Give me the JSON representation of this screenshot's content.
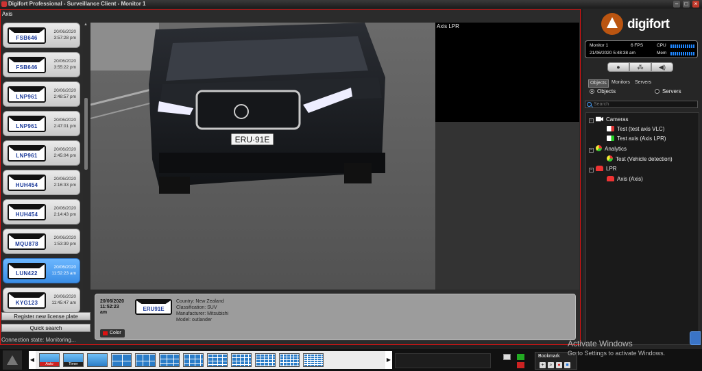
{
  "window": {
    "title": "Digifort Professional - Surveillance Client - Monitor 1"
  },
  "monitor": {
    "label": "Axis",
    "connection_state": "Connection state: Monitoring..."
  },
  "plates": [
    {
      "plate": "FSB646",
      "date": "20/06/2020",
      "time": "3:57:28 pm",
      "selected": false
    },
    {
      "plate": "FSB646",
      "date": "20/06/2020",
      "time": "3:55:22 pm",
      "selected": false
    },
    {
      "plate": "LNP961",
      "date": "20/06/2020",
      "time": "2:48:57 pm",
      "selected": false
    },
    {
      "plate": "LNP961",
      "date": "20/06/2020",
      "time": "2:47:01 pm",
      "selected": false
    },
    {
      "plate": "LNP961",
      "date": "20/06/2020",
      "time": "2:45:04 pm",
      "selected": false
    },
    {
      "plate": "HUH454",
      "date": "20/06/2020",
      "time": "2:16:33 pm",
      "selected": false
    },
    {
      "plate": "HUH454",
      "date": "20/06/2020",
      "time": "2:14:43 pm",
      "selected": false
    },
    {
      "plate": "MQU878",
      "date": "20/06/2020",
      "time": "1:53:39 pm",
      "selected": false
    },
    {
      "plate": "LUN422",
      "date": "20/06/2020",
      "time": "11:52:23 am",
      "selected": true
    },
    {
      "plate": "KYG123",
      "date": "20/06/2020",
      "time": "11:45:47 am",
      "selected": false
    }
  ],
  "buttons": {
    "register": "Register new license plate",
    "quick_search": "Quick search"
  },
  "video": {
    "title": "Axis LPR",
    "plate_on_car": "ERU·91E"
  },
  "info": {
    "date": "20/06/2020",
    "time": "11:52:23",
    "ampm": "am",
    "plate": "ERU91E",
    "country": "Country: New Zealand",
    "classification": "Classification: SUV",
    "manufacturer": "Manufacturer: Mitsubishi",
    "model": "Model: outlander",
    "color_label": "Color",
    "color_value": "#dd1111"
  },
  "right_panel": {
    "logo": "digifort",
    "status": {
      "monitor": "Monitor 1",
      "fps": "6 FPS",
      "cpu": "CPU",
      "datetime": "21/06/2020 5:48:38 am",
      "mem": "Mem"
    },
    "tabs": [
      "Objects",
      "Monitors",
      "Servers"
    ],
    "radios": {
      "objects": "Objects",
      "servers": "Servers"
    },
    "search_placeholder": "Search",
    "tree": {
      "cameras": "Cameras",
      "camera_1": "Test (test axis VLC)",
      "camera_2": "Test axis (Axis LPR)",
      "analytics": "Analytics",
      "analytics_1": "Test (Vehicle detection)",
      "lpr": "LPR",
      "lpr_1": "Axis (Axis)"
    }
  },
  "bottom": {
    "layout_auto": "Auto",
    "layout_timer": "Timer",
    "bookmark": "Bookmark"
  },
  "watermark": {
    "title": "Activate Windows",
    "subtitle": "Go to Settings to activate Windows."
  },
  "colors": {
    "accent_red": "#dd1111",
    "selected_blue": "#3b8ee6",
    "meter_blue": "#1e86ff"
  }
}
